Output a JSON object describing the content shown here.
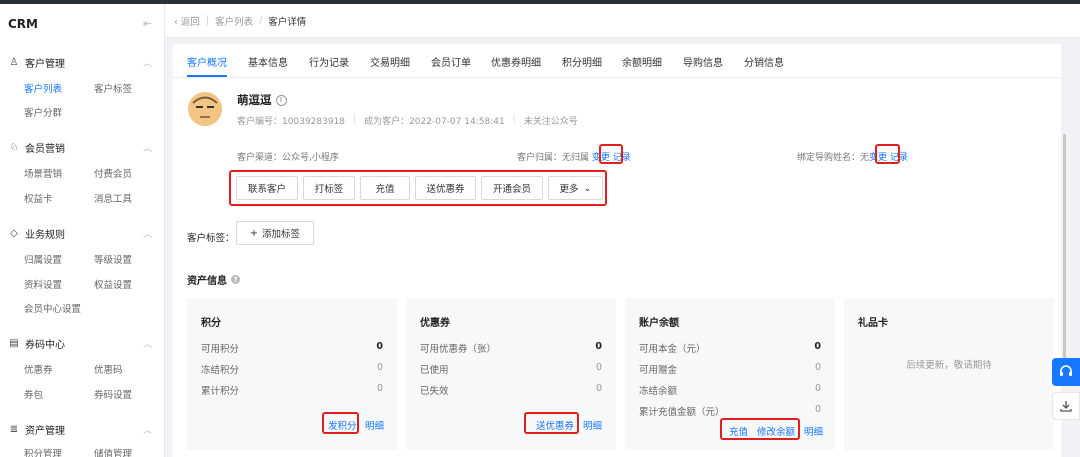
{
  "sidebar": {
    "brand": "CRM",
    "collapse_icon": "collapse-icon",
    "groups": [
      {
        "title": "客户管理",
        "icon": "user-icon",
        "items": [
          "客户列表",
          "客户标签",
          "客户分群"
        ]
      },
      {
        "title": "会员营销",
        "icon": "member-icon",
        "items": [
          "场景营销",
          "付费会员",
          "权益卡",
          "消息工具"
        ]
      },
      {
        "title": "业务规则",
        "icon": "rule-icon",
        "items": [
          "归属设置",
          "等级设置",
          "资料设置",
          "权益设置",
          "会员中心设置"
        ]
      },
      {
        "title": "券码中心",
        "icon": "ticket-icon",
        "items": [
          "优惠券",
          "优惠码",
          "券包",
          "券码设置"
        ]
      },
      {
        "title": "资产管理",
        "icon": "database-icon",
        "items": [
          "积分管理",
          "储值管理"
        ]
      }
    ],
    "active_item": "客户列表"
  },
  "breadcrumb": {
    "back": "返回",
    "parent": "客户列表",
    "separator": "/",
    "current": "客户详情"
  },
  "tabs": [
    "客户概况",
    "基本信息",
    "行为记录",
    "交易明细",
    "会员订单",
    "优惠券明细",
    "积分明细",
    "余额明细",
    "导购信息",
    "分销信息"
  ],
  "customer": {
    "name": "萌逗逗",
    "id_label": "客户编号：",
    "id": "10039283918",
    "since_label": "成为客户：",
    "since": "2022-07-07 14:58:41",
    "follow": "未关注公众号",
    "channel_label": "客户渠道：",
    "channel": "公众号,小程序",
    "owner_label": "客户归属：",
    "owner": "无归属",
    "guide_label": "绑定导购姓名：",
    "guide": "无",
    "change": "变更",
    "record": "记录"
  },
  "actions": [
    "联系客户",
    "打标签",
    "充值",
    "送优惠券",
    "开通会员",
    "更多"
  ],
  "tags": {
    "label": "客户标签：",
    "add": "添加标签"
  },
  "assets": {
    "title": "资产信息",
    "cards": [
      {
        "title": "积分",
        "rows": [
          {
            "k": "可用积分",
            "v": "0"
          },
          {
            "k": "冻结积分",
            "v": "0"
          },
          {
            "k": "累计积分",
            "v": "0"
          }
        ],
        "actions": [
          "发积分",
          "明细"
        ]
      },
      {
        "title": "优惠券",
        "rows": [
          {
            "k": "可用优惠券（张）",
            "v": "0"
          },
          {
            "k": "已使用",
            "v": "0"
          },
          {
            "k": "已失效",
            "v": "0"
          }
        ],
        "actions": [
          "送优惠券",
          "明细"
        ]
      },
      {
        "title": "账户余额",
        "rows": [
          {
            "k": "可用本金（元）",
            "v": "0"
          },
          {
            "k": "可用赠金",
            "v": "0"
          },
          {
            "k": "冻结余额",
            "v": "0"
          },
          {
            "k": "累计充值金额（元）",
            "v": "0"
          }
        ],
        "actions": [
          "充值",
          "修改余额",
          "明细"
        ]
      },
      {
        "title": "礼品卡",
        "empty": "后续更新，敬请期待"
      }
    ]
  },
  "accent": "#1677ff",
  "highlight": "#e0201e"
}
